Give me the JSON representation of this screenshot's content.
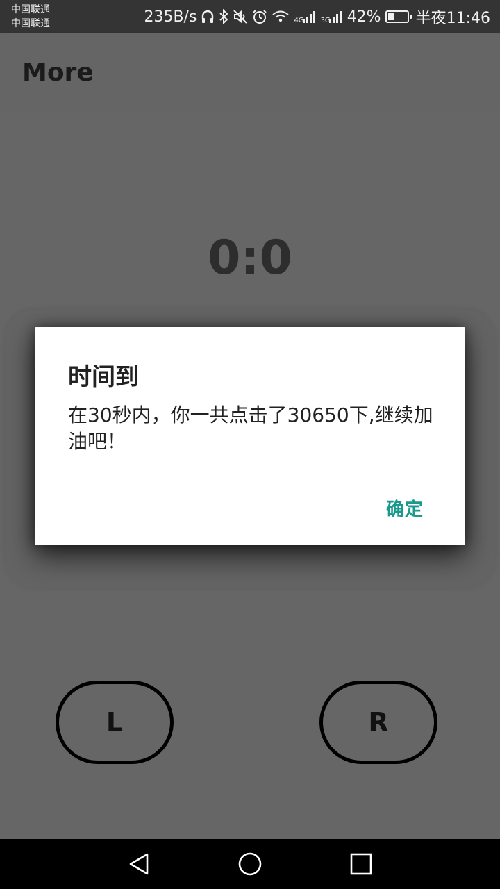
{
  "status_bar": {
    "carrier_1": "中国联通",
    "carrier_2": "中国联通",
    "net_speed": "235B/s",
    "signal_1_label": "4G",
    "signal_2_label": "3G",
    "battery": "42%",
    "battery_level": 0.42,
    "time": "半夜11:46",
    "icons": [
      "headphones-icon",
      "bluetooth-icon",
      "mute-icon",
      "alarm-icon",
      "wifi-icon",
      "signal-icon",
      "battery-icon"
    ]
  },
  "app_bar": {
    "title": "More"
  },
  "game": {
    "score": "0:0",
    "left_button": "L",
    "right_button": "R"
  },
  "dialog": {
    "title": "时间到",
    "message": "在30秒内，你一共点击了30650下,继续加油吧！",
    "ok_label": "确定",
    "ok_color": "#199a8c"
  },
  "nav_bar": {
    "icons": [
      "back-icon",
      "home-icon",
      "recents-icon"
    ]
  }
}
